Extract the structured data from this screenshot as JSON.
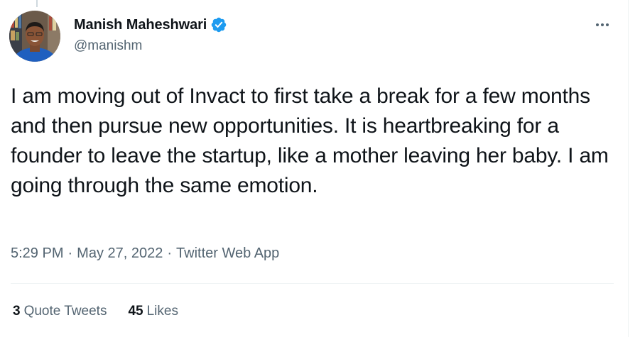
{
  "tweet": {
    "author": {
      "display_name": "Manish Maheshwari",
      "handle": "@manishm",
      "verified": true
    },
    "text": "I am moving out of Invact to first take a break for a few months and then pursue new opportunities. It is heartbreaking for a founder to leave the startup, like a mother leaving her baby. I am going through the same emotion.",
    "time": "5:29 PM",
    "date": "May 27, 2022",
    "source": "Twitter Web App",
    "separator": "·",
    "stats": {
      "quote_tweets": {
        "count": "3",
        "label": "Quote Tweets"
      },
      "likes": {
        "count": "45",
        "label": "Likes"
      }
    },
    "more_icon": "more-horizontal-icon",
    "colors": {
      "verified_blue": "#1d9bf0",
      "text_primary": "#0f1419",
      "text_secondary": "#536471"
    }
  }
}
